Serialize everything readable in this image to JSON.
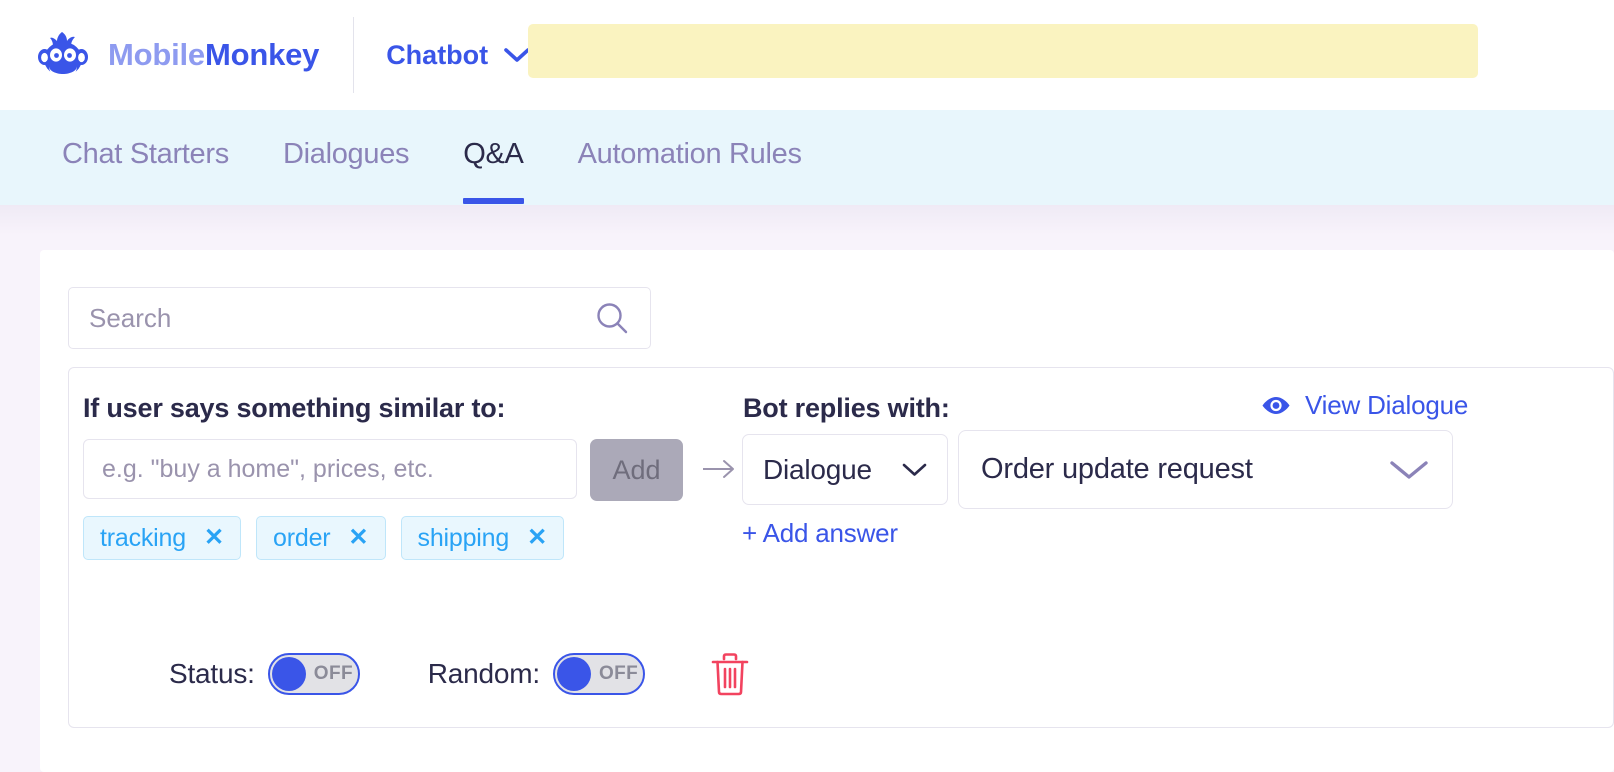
{
  "header": {
    "brand_pale": "Mobile",
    "brand_bold": "Monkey",
    "logo_icon": "monkey-head-icon",
    "workspace_label": "Chatbot",
    "workspace_chevron_icon": "chevron-down-icon",
    "notice_banner_color": "#faf3c0"
  },
  "tabs": [
    {
      "label": "Chat Starters",
      "active": false
    },
    {
      "label": "Dialogues",
      "active": false
    },
    {
      "label": "Q&A",
      "active": true
    },
    {
      "label": "Automation Rules",
      "active": false
    }
  ],
  "search": {
    "value": "",
    "placeholder": "Search",
    "icon": "search-icon"
  },
  "qa_card": {
    "trigger_label": "If user says something similar to:",
    "reply_label": "Bot replies with:",
    "view_dialogue": {
      "icon": "eye-icon",
      "label": "View Dialogue"
    },
    "keyword_input": {
      "value": "",
      "placeholder": "e.g. \"buy a home\", prices, etc."
    },
    "add_button_label": "Add",
    "arrow_icon": "arrow-right-icon",
    "answer_type": {
      "selected": "Dialogue",
      "chevron_icon": "chevron-down-icon"
    },
    "answer_value": {
      "selected": "Order update request",
      "chevron_icon": "chevron-down-icon"
    },
    "add_answer_label": "+ Add answer",
    "keywords": [
      {
        "label": "tracking",
        "remove_icon": "close-icon"
      },
      {
        "label": "order",
        "remove_icon": "close-icon"
      },
      {
        "label": "shipping",
        "remove_icon": "close-icon"
      }
    ],
    "status_toggle": {
      "caption": "Status:",
      "state": "OFF"
    },
    "random_toggle": {
      "caption": "Random:",
      "state": "OFF"
    },
    "delete_icon": "trash-icon"
  },
  "colors": {
    "brand_blue": "#3a55e8",
    "tab_strip_bg": "#e8f6fc",
    "page_bg": "#f8f3fb",
    "chip_text": "#29a3f5",
    "chip_bg": "#e9f7fe",
    "delete_red": "#f2435f",
    "banner_yellow": "#faf3c0"
  }
}
